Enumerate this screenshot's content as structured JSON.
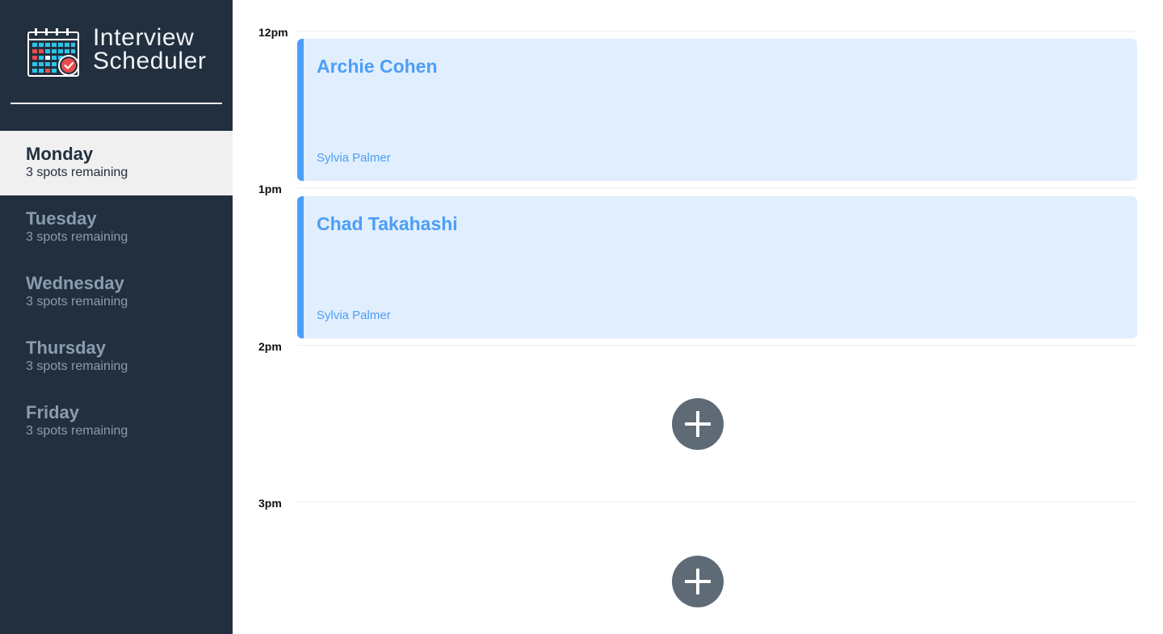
{
  "app": {
    "title_line1": "Interview",
    "title_line2": "Scheduler"
  },
  "days": [
    {
      "name": "Monday",
      "spots": "3 spots remaining",
      "selected": true
    },
    {
      "name": "Tuesday",
      "spots": "3 spots remaining",
      "selected": false
    },
    {
      "name": "Wednesday",
      "spots": "3 spots remaining",
      "selected": false
    },
    {
      "name": "Thursday",
      "spots": "3 spots remaining",
      "selected": false
    },
    {
      "name": "Friday",
      "spots": "3 spots remaining",
      "selected": false
    }
  ],
  "schedule": {
    "times": [
      "12pm",
      "1pm",
      "2pm",
      "3pm"
    ],
    "appointments": [
      {
        "time": "12pm",
        "student": "Archie Cohen",
        "interviewer": "Sylvia Palmer"
      },
      {
        "time": "1pm",
        "student": "Chad Takahashi",
        "interviewer": "Sylvia Palmer"
      }
    ],
    "empty_slots": [
      "2pm",
      "3pm"
    ]
  },
  "icons": {
    "logo": "calendar-check-icon",
    "add": "plus-icon"
  },
  "colors": {
    "sidebar_bg": "#222f3e",
    "selected_day_bg": "#f0f0f0",
    "appointment_bg": "#e1eefd",
    "appointment_accent": "#4d9ef6",
    "add_button_bg": "#5e6a75"
  }
}
